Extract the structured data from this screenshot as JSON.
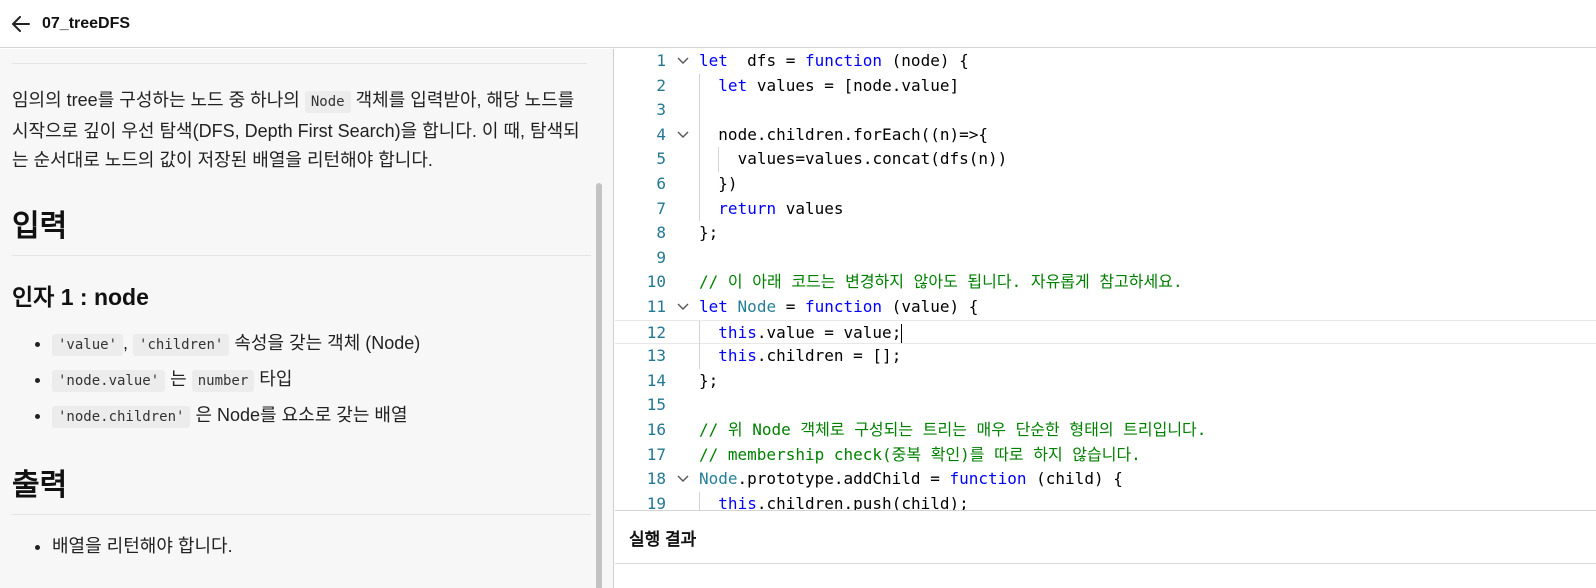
{
  "header": {
    "title": "07_treeDFS",
    "back_icon": "arrow-left-icon"
  },
  "problem": {
    "desc": [
      "임의의 tree를 구성하는 노드 중 하나의 ",
      "Node",
      " 객체를 입력받아, 해당 노드를 시작으로 깊이 우선 탐색(DFS, Depth First Search)을 합니다. 이 때, 탐색되는 순서대로 노드의 값이 저장된 배열을 리턴해야 합니다."
    ],
    "input_heading": "입력",
    "arg_heading": "인자 1 : node",
    "arg_items": [
      {
        "parts": [
          {
            "code": "'value'"
          },
          {
            "text": ", "
          },
          {
            "code": "'children'"
          },
          {
            "text": " 속성을 갖는 객체 (Node)"
          }
        ]
      },
      {
        "parts": [
          {
            "code": "'node.value'"
          },
          {
            "text": " 는 "
          },
          {
            "code": "number"
          },
          {
            "text": " 타입"
          }
        ]
      },
      {
        "parts": [
          {
            "code": "'node.children'"
          },
          {
            "text": " 은 Node를 요소로 갖는 배열"
          }
        ]
      }
    ],
    "output_heading": "출력",
    "output_items": [
      "배열을 리턴해야 합니다."
    ]
  },
  "editor": {
    "lines": [
      {
        "n": "1",
        "fold": true,
        "indent": 0,
        "tokens": [
          [
            "kw",
            "let"
          ],
          [
            "",
            "  dfs = "
          ],
          [
            "kw",
            "function"
          ],
          [
            "",
            " (node) {"
          ]
        ]
      },
      {
        "n": "2",
        "indent": 1,
        "tokens": [
          [
            "kw",
            "let"
          ],
          [
            "",
            " values = [node.value]"
          ]
        ]
      },
      {
        "n": "3",
        "indent": 1,
        "tokens": []
      },
      {
        "n": "4",
        "fold": true,
        "indent": 1,
        "tokens": [
          [
            "",
            "node.children.forEach((n)=>{"
          ]
        ]
      },
      {
        "n": "5",
        "indent": 2,
        "tokens": [
          [
            "",
            "values=values.concat(dfs(n))"
          ]
        ]
      },
      {
        "n": "6",
        "indent": 1,
        "tokens": [
          [
            "",
            "})"
          ]
        ]
      },
      {
        "n": "7",
        "indent": 1,
        "tokens": [
          [
            "kw",
            "return"
          ],
          [
            "",
            " values"
          ]
        ]
      },
      {
        "n": "8",
        "indent": 0,
        "tokens": [
          [
            "",
            "};"
          ]
        ]
      },
      {
        "n": "9",
        "indent": 0,
        "tokens": []
      },
      {
        "n": "10",
        "indent": 0,
        "tokens": [
          [
            "cm",
            "// 이 아래 코드는 변경하지 않아도 됩니다. 자유롭게 참고하세요."
          ]
        ]
      },
      {
        "n": "11",
        "fold": true,
        "indent": 0,
        "tokens": [
          [
            "kw",
            "let"
          ],
          [
            "",
            " "
          ],
          [
            "ty",
            "Node"
          ],
          [
            "",
            " = "
          ],
          [
            "kw",
            "function"
          ],
          [
            "",
            " (value) {"
          ]
        ]
      },
      {
        "n": "12",
        "indent": 1,
        "current": true,
        "tokens": [
          [
            "kw",
            "this"
          ],
          [
            "",
            ".value = value;"
          ]
        ]
      },
      {
        "n": "13",
        "indent": 1,
        "tokens": [
          [
            "kw",
            "this"
          ],
          [
            "",
            ".children = [];"
          ]
        ]
      },
      {
        "n": "14",
        "indent": 0,
        "tokens": [
          [
            "",
            "};"
          ]
        ]
      },
      {
        "n": "15",
        "indent": 0,
        "tokens": []
      },
      {
        "n": "16",
        "indent": 0,
        "tokens": [
          [
            "cm",
            "// 위 Node 객체로 구성되는 트리는 매우 단순한 형태의 트리입니다."
          ]
        ]
      },
      {
        "n": "17",
        "indent": 0,
        "tokens": [
          [
            "cm",
            "// membership check(중복 확인)를 따로 하지 않습니다."
          ]
        ]
      },
      {
        "n": "18",
        "fold": true,
        "indent": 0,
        "tokens": [
          [
            "ty",
            "Node"
          ],
          [
            "",
            ".prototype.addChild = "
          ],
          [
            "kw",
            "function"
          ],
          [
            "",
            " (child) {"
          ]
        ]
      },
      {
        "n": "19",
        "indent": 1,
        "tokens": [
          [
            "kw",
            "this"
          ],
          [
            "",
            ".children.push(child);"
          ]
        ]
      }
    ]
  },
  "result": {
    "title": "실행 결과"
  }
}
